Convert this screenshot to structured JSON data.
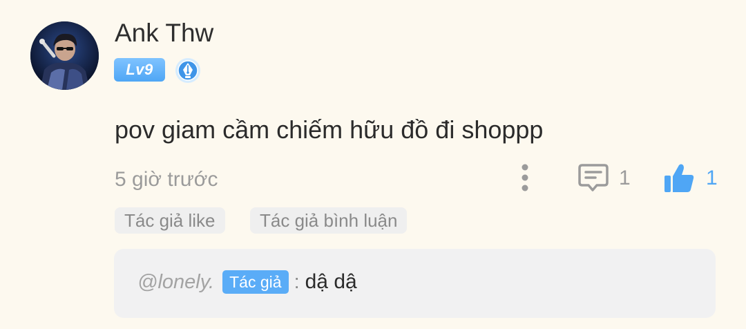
{
  "comment": {
    "username": "Ank Thw",
    "level_badge": "Lv9",
    "text": "pov giam cầm chiếm hữu đồ đi shoppp",
    "timestamp": "5 giờ trước",
    "reply_count": "1",
    "like_count": "1",
    "tags": [
      "Tác giả like",
      "Tác giả bình luận"
    ]
  },
  "reply_preview": {
    "mention": "@lonely.",
    "author_badge": "Tác giả",
    "separator": ":",
    "text": "dậ dậ"
  },
  "icons": {
    "avatar": "avatar-image",
    "badge": "pen-nib-badge-icon",
    "more": "more-vertical-icon",
    "reply": "comment-bubble-icon",
    "like": "thumbs-up-icon"
  },
  "colors": {
    "background": "#fdf9ef",
    "accent_blue": "#4fa6f5",
    "muted_gray": "#9b9b9b",
    "tag_background": "#efefef",
    "reply_box_background": "#f1f1f2"
  }
}
